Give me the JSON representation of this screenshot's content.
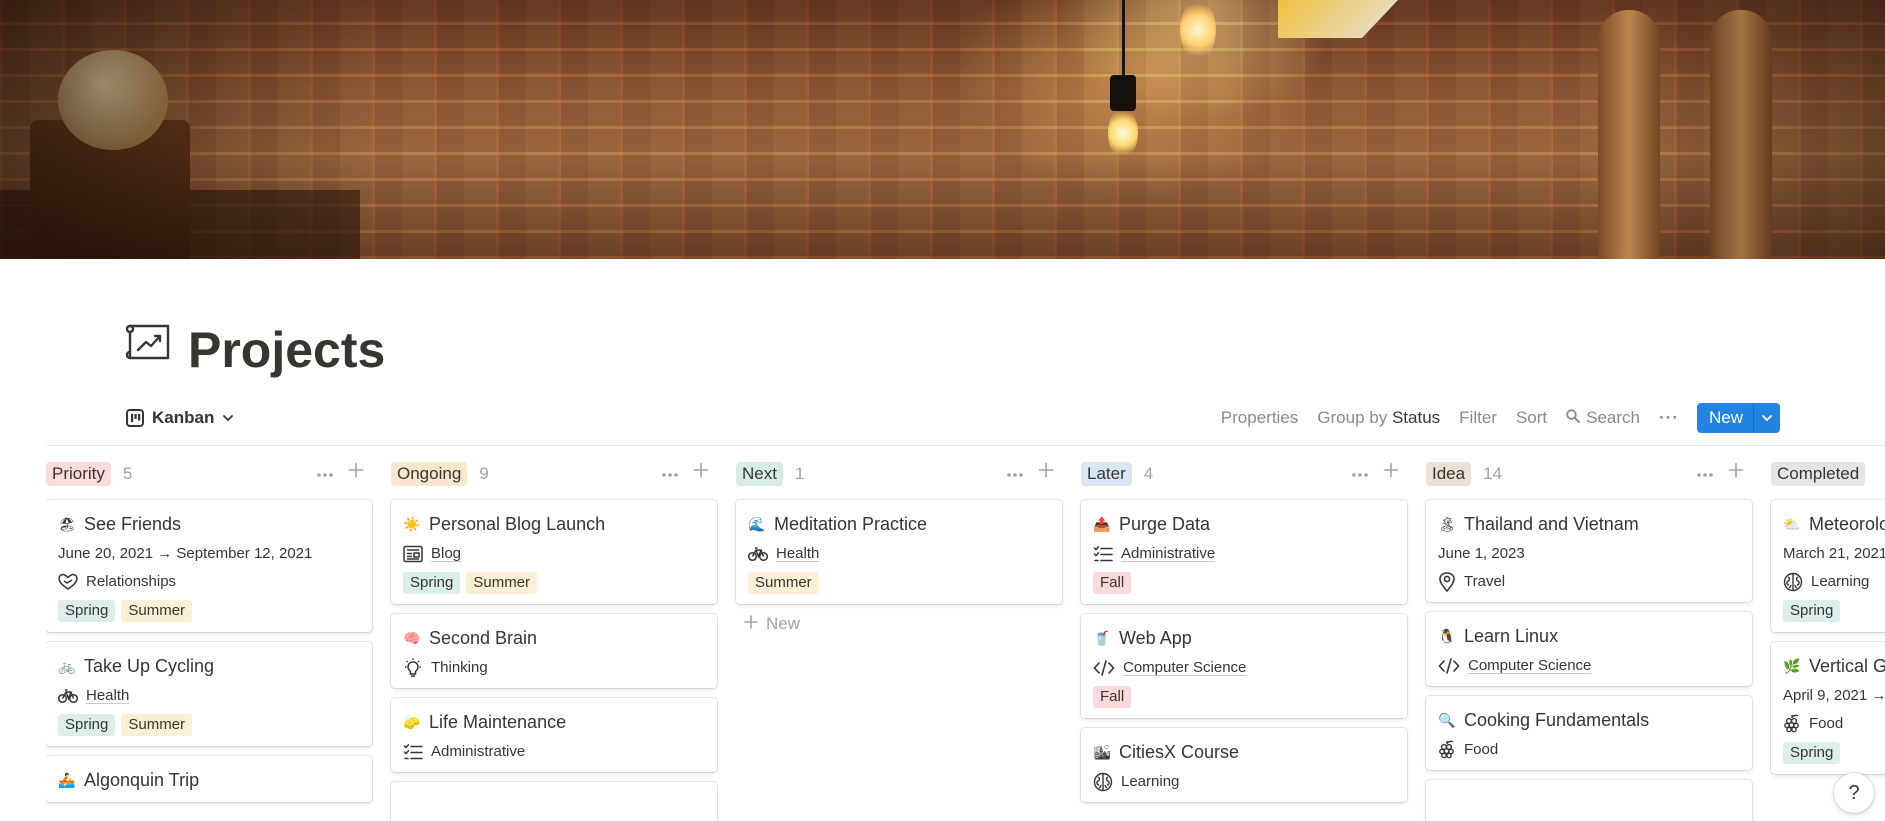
{
  "page": {
    "title": "Projects"
  },
  "view": {
    "label": "Kanban"
  },
  "toolbar": {
    "properties": "Properties",
    "group_by": "Group by",
    "group_by_value": "Status",
    "filter": "Filter",
    "sort": "Sort",
    "search": "Search",
    "more": "···",
    "new": "New"
  },
  "tag_colors": {
    "Spring": "#dbeeec",
    "Summer": "#fbf0d6",
    "Fall": "#fbd9dc"
  },
  "columns": [
    {
      "name": "Priority",
      "count": "5",
      "color": "#fbdbdc",
      "cards": [
        {
          "title": "See Friends",
          "emoji": "🏖",
          "date": "June 20, 2021 → September 12, 2021",
          "category": "Relationships",
          "category_icon": "heart-hands-icon",
          "category_link": false,
          "tags": [
            "Spring",
            "Summer"
          ]
        },
        {
          "title": "Take Up Cycling",
          "emoji": "🚲",
          "category": "Health",
          "category_icon": "bicycle-icon",
          "category_link": true,
          "tags": [
            "Spring",
            "Summer"
          ]
        },
        {
          "title": "Algonquin Trip",
          "emoji": "🚣"
        }
      ]
    },
    {
      "name": "Ongoing",
      "count": "9",
      "color": "#fbe7cf",
      "cards": [
        {
          "title": "Personal Blog Launch",
          "emoji": "☀️",
          "category": "Blog",
          "category_icon": "newspaper-icon",
          "category_link": true,
          "tags": [
            "Spring",
            "Summer"
          ]
        },
        {
          "title": "Second Brain",
          "emoji": "🧠",
          "category": "Thinking",
          "category_icon": "lightbulb-icon",
          "category_link": false
        },
        {
          "title": "Life Maintenance",
          "emoji": "🧽",
          "category": "Administrative",
          "category_icon": "checklist-icon",
          "category_link": false
        },
        {
          "title": ""
        }
      ]
    },
    {
      "name": "Next",
      "count": "1",
      "color": "#d6ede5",
      "cards": [
        {
          "title": "Meditation Practice",
          "emoji": "🌊",
          "category": "Health",
          "category_icon": "bicycle-icon",
          "category_link": true,
          "tags": [
            "Summer"
          ]
        }
      ],
      "new_label": "New"
    },
    {
      "name": "Later",
      "count": "4",
      "color": "#d7e7f5",
      "cards": [
        {
          "title": "Purge Data",
          "emoji": "📤",
          "category": "Administrative",
          "category_icon": "checklist-icon",
          "category_link": true,
          "tags": [
            "Fall"
          ]
        },
        {
          "title": "Web App",
          "emoji": "🥤",
          "category": "Computer Science",
          "category_icon": "code-icon",
          "category_link": true,
          "tags": [
            "Fall"
          ]
        },
        {
          "title": "CitiesX Course",
          "emoji": "🏙",
          "category": "Learning",
          "category_icon": "brain-icon",
          "category_link": false
        }
      ]
    },
    {
      "name": "Idea",
      "count": "14",
      "color": "#ecdfd5",
      "cards": [
        {
          "title": "Thailand and Vietnam",
          "emoji": "🏝",
          "date": "June 1, 2023",
          "category": "Travel",
          "category_icon": "location-pin-icon",
          "category_link": false
        },
        {
          "title": "Learn Linux",
          "emoji": "🐧",
          "category": "Computer Science",
          "category_icon": "code-icon",
          "category_link": true
        },
        {
          "title": "Cooking Fundamentals",
          "emoji": "🔍",
          "category": "Food",
          "category_icon": "grapes-icon",
          "category_link": false
        },
        {
          "title": ""
        }
      ]
    },
    {
      "name": "Completed",
      "count": "",
      "color": "#e6e5e3",
      "cards": [
        {
          "title": "Meteorolo",
          "emoji": "⛅",
          "date": "March 21, 2021",
          "category": "Learning",
          "category_icon": "brain-icon",
          "category_link": false,
          "tags": [
            "Spring"
          ]
        },
        {
          "title": "Vertical Ga",
          "emoji": "🌿",
          "date": "April 9, 2021 →",
          "category": "Food",
          "category_icon": "grapes-icon",
          "category_link": false,
          "tags": [
            "Spring"
          ]
        }
      ]
    }
  ],
  "help": {
    "label": "?"
  }
}
